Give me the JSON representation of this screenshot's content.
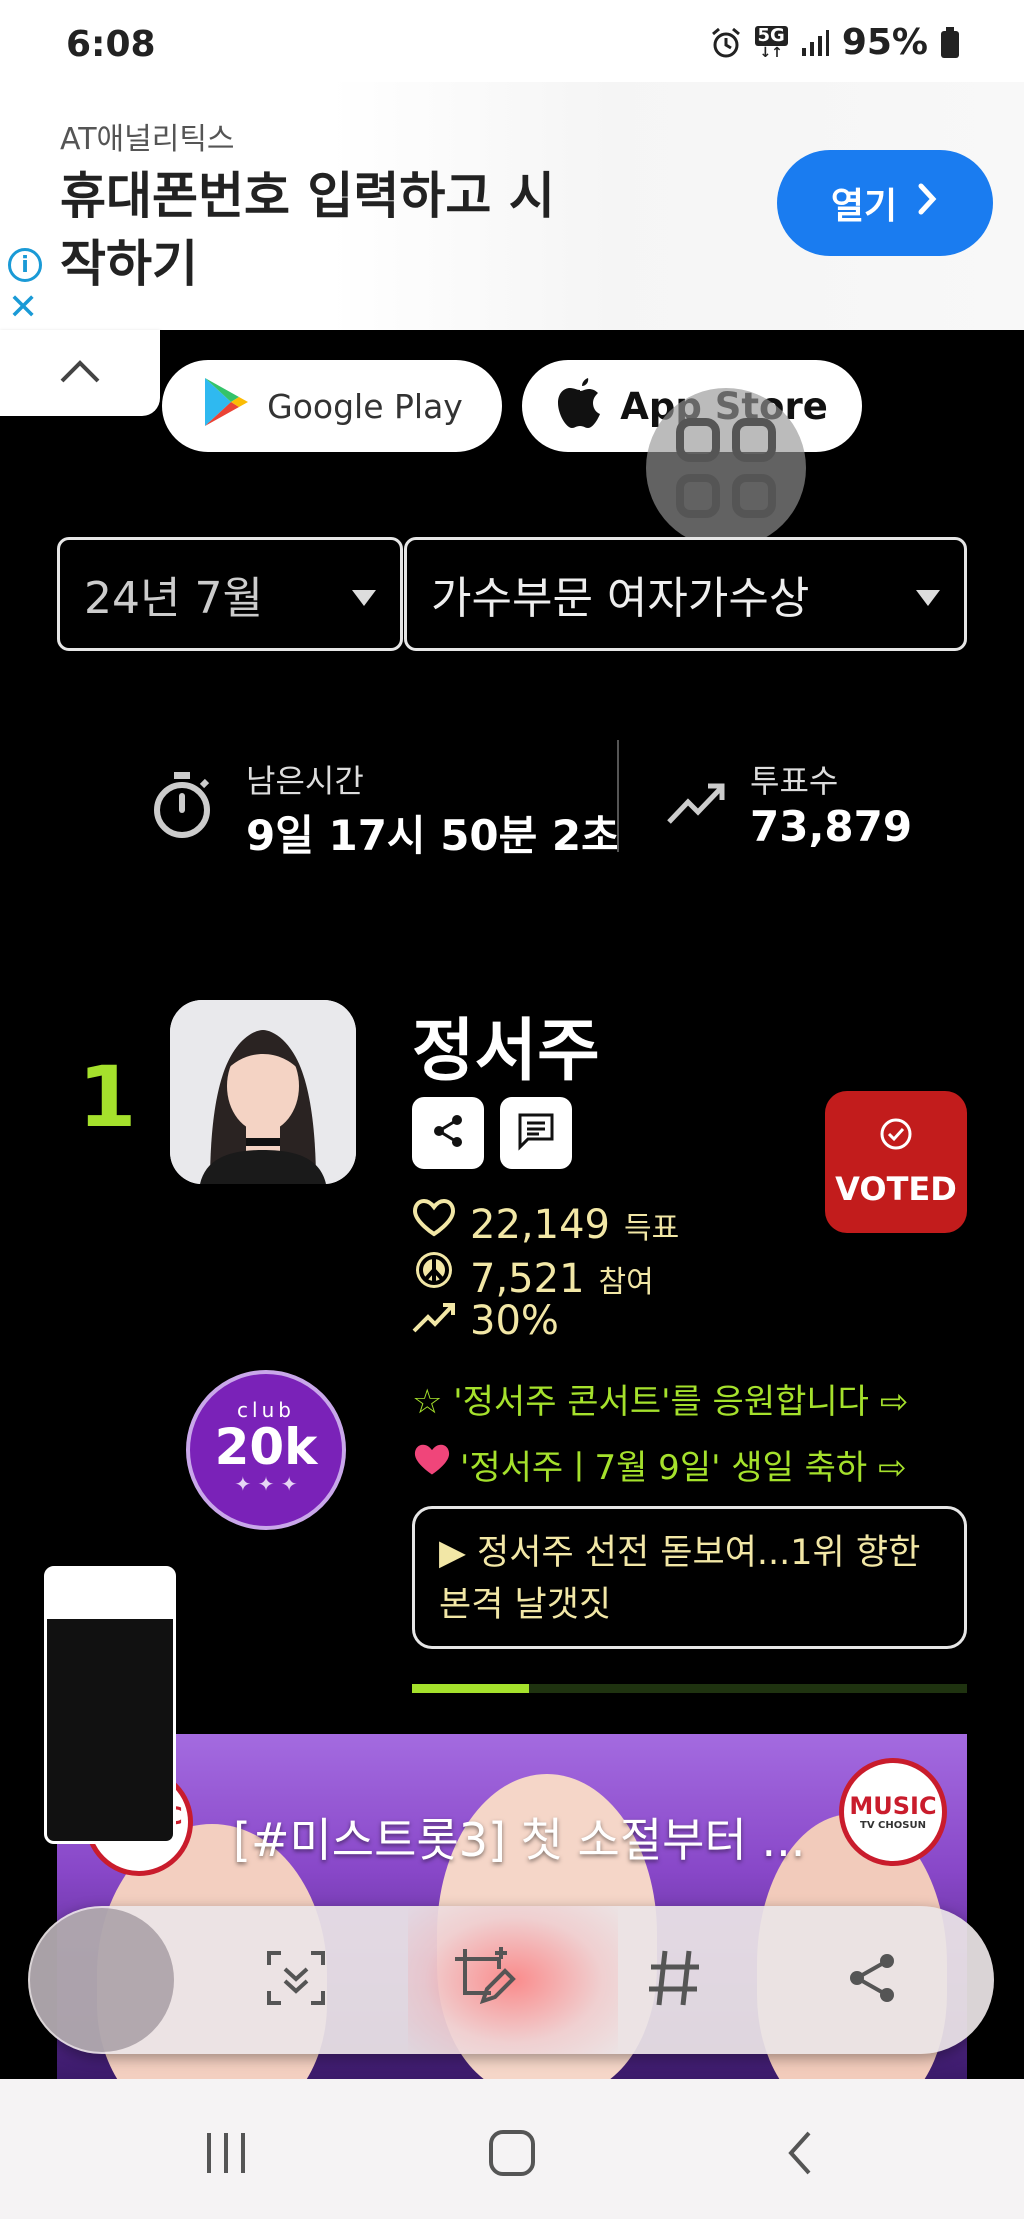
{
  "status": {
    "time": "6:08",
    "battery": "95%",
    "network": "5G"
  },
  "ad": {
    "brand": "AT애널리틱스",
    "headline": "휴대폰번호 입력하고 시작하기",
    "open_label": "열기"
  },
  "store": {
    "google_label": "Google Play",
    "apple_label": "App Store"
  },
  "filters": {
    "month": "24년 7월",
    "category": "가수부문 여자가수상"
  },
  "stats": {
    "time_label": "남은시간",
    "time_value": "9일 17시 50분 2초",
    "votes_label": "투표수",
    "votes_value": "73,879"
  },
  "entry": {
    "rank": "1",
    "name": "정서주",
    "voted_label": "VOTED",
    "votes": "22,149",
    "votes_unit": "득표",
    "participants": "7,521",
    "participants_unit": "참여",
    "percent": "30%",
    "club_word": "club",
    "club_level": "20k",
    "support_1": "☆ '정서주 콘서트'를 응원합니다 ⇨",
    "support_2": "'정서주ㅣ7월 9일' 생일 축하 ⇨",
    "news": "▶ 정서주 선전 돋보여...1위 향한 본격 날갯짓",
    "progress": 0.21
  },
  "video": {
    "title": "[#미스트롯3] 첫 소절부터 ...",
    "logo": "MUSIC",
    "logo_sub": "TV CHOSUN"
  },
  "colors": {
    "accent": "#a5e12c",
    "voted": "#c21c1c",
    "ad_button": "#1a7cf0",
    "highlight": "#f2e7a6"
  }
}
